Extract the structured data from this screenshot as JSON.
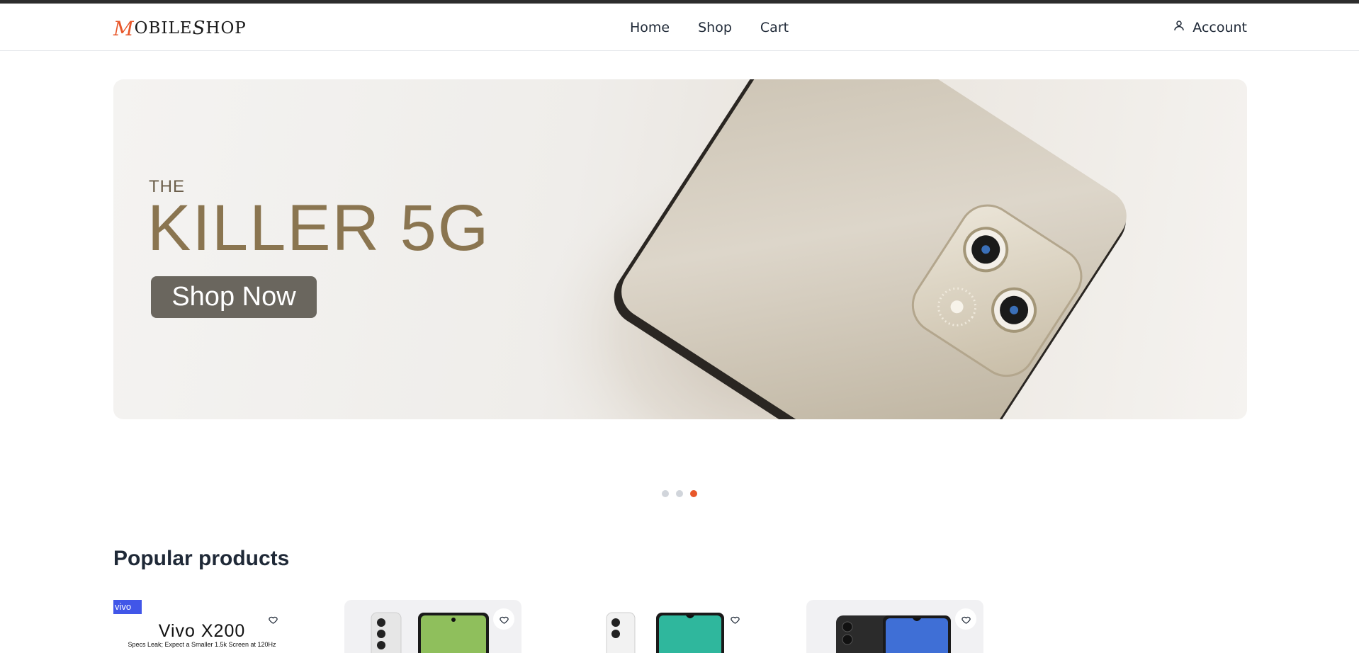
{
  "brand": {
    "logo_text_first": "M",
    "logo_text_rest": "OBILE ",
    "logo_text_s": "S",
    "logo_text_end": "HOP"
  },
  "nav": {
    "items": [
      {
        "label": "Home"
      },
      {
        "label": "Shop"
      },
      {
        "label": "Cart"
      }
    ],
    "account_label": "Account"
  },
  "hero": {
    "pretitle": "THE",
    "title": "KILLER 5G",
    "cta_label": "Shop Now",
    "slides_total": 3,
    "active_slide": 3
  },
  "popular": {
    "title": "Popular products",
    "products": [
      {
        "badge": "vivo",
        "promo_title": "Vivo X200",
        "promo_subtitle": "Specs Leak; Expect a Smaller 1.5k Screen at 120Hz"
      },
      {},
      {},
      {}
    ]
  },
  "colors": {
    "accent": "#e8572a",
    "hero_button": "#6a665e",
    "vivo_blue": "#4156e8"
  },
  "icons": {
    "account": "user-icon",
    "favorite": "heart-icon"
  }
}
